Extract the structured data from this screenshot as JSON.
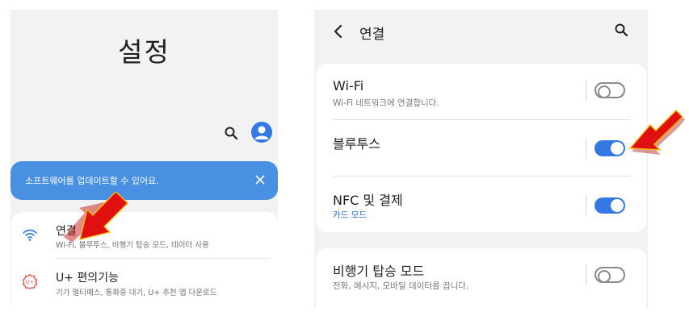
{
  "left_screen": {
    "title": "설정",
    "banner": {
      "text": "소프트웨어를 업데이트할 수 있어요."
    },
    "items": [
      {
        "label": "연결",
        "subtitle": "Wi-Fi, 블루투스, 비행기 탑승 모드, 데이터 사용"
      },
      {
        "label": "U+ 편의기능",
        "subtitle": "기가 멀티패스, 통화중 대기, U+ 추천 앱 다운로드"
      }
    ]
  },
  "right_screen": {
    "header": {
      "title": "연결"
    },
    "settings": [
      {
        "label": "Wi-Fi",
        "subtitle": "Wi-Fi 네트워크에 연결합니다.",
        "enabled": false
      },
      {
        "label": "블루투스",
        "subtitle": "",
        "enabled": true
      },
      {
        "label": "NFC 및 결제",
        "subtitle": "카드 모드",
        "enabled": true
      },
      {
        "label": "비행기 탑승 모드",
        "subtitle": "전화, 메시지, 모바일 데이터를 끕니다.",
        "enabled": false
      }
    ]
  },
  "colors": {
    "accent": "#3478e4",
    "banner": "#4a90e2",
    "arrow": "#e01010"
  },
  "icons": [
    "search-icon",
    "profile-icon",
    "close-icon",
    "wifi-icon",
    "plus-service-icon",
    "back-icon",
    "red-arrow-icon"
  ]
}
